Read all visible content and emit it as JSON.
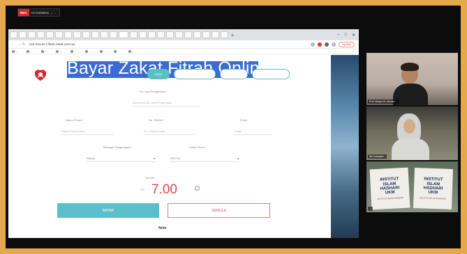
{
  "recording": {
    "badge": "REC",
    "host": "ACTADMIN1 ..."
  },
  "browser": {
    "tabs": [
      "",
      "",
      "",
      "",
      "",
      "",
      "",
      "",
      "",
      "",
      "",
      "",
      "",
      "",
      "",
      "",
      "",
      "",
      "",
      "",
      "",
      "",
      "",
      ""
    ],
    "new_tab": "+",
    "window_controls": [
      "–",
      "□",
      "✕"
    ],
    "address": {
      "url": "Not Secure  |  fitrah.zakat.com.my"
    },
    "update_label": "Update",
    "bookmarks": [
      "...",
      "...",
      "...",
      "...",
      "...",
      "...",
      "...",
      "...",
      "..."
    ]
  },
  "page": {
    "title": "Bayar Zakat Fitrah Online",
    "nav_pills": [
      "ZAKAT",
      "",
      "",
      ""
    ],
    "form": {
      "no_kad_label": "No. Kad Pengenalan *",
      "no_kad_placeholder": "Masukkan No. Kad Pengenalan",
      "nama_label": "Nama Penuh *",
      "nama_placeholder": "Nama Penuh Anda",
      "telefon_label": "No. Telefon *",
      "telefon_placeholder": "No. Telefon Anda",
      "email_label": "Email",
      "email_placeholder": "Email",
      "select1_label": "Bilangan Tanggungan *",
      "select1_value": "Pilihan",
      "select2_label": "Kadar Fitrah *",
      "select2_value": "RM7.00",
      "caret": "▾"
    },
    "jumlah_label": "Jumlah",
    "currency": "RM",
    "amount": "7.00",
    "info_icon": "i",
    "bayar_button": "BAYAR",
    "reset_button": "SEMULA",
    "footer": "Nota"
  },
  "participants": [
    {
      "name": "Prof. Madya Dr. Ahmad ..."
    },
    {
      "name": "Siti Zubaidah..."
    },
    {
      "name": "..."
    }
  ],
  "banner": {
    "line1": "INSTITUT",
    "line2": "ISLAM",
    "line3": "HADHARI",
    "line4": "UKM",
    "sub": "INSTITUT ISLAM HADHARI"
  }
}
